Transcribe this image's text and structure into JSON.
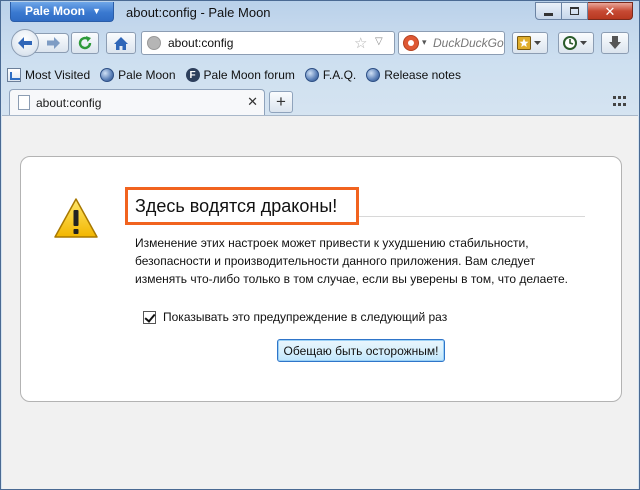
{
  "titlebar": {
    "app_menu_label": "Pale Moon",
    "window_title": "about:config - Pale Moon"
  },
  "navbar": {
    "url": "about:config",
    "search_placeholder": "DuckDuckGo"
  },
  "bookmarks": {
    "items": [
      {
        "label": "Most Visited",
        "icon": "most-visited-icon"
      },
      {
        "label": "Pale Moon",
        "icon": "globe-icon"
      },
      {
        "label": "Pale Moon forum",
        "icon": "forum-f-icon"
      },
      {
        "label": "F.A.Q.",
        "icon": "globe-icon"
      },
      {
        "label": "Release notes",
        "icon": "globe-icon"
      }
    ]
  },
  "tabs": [
    {
      "label": "about:config",
      "active": true
    }
  ],
  "warning": {
    "heading": "Здесь водятся драконы!",
    "description": "Изменение этих настроек может привести к ухудшению стабильности, безопасности и производительности данного приложения. Вам следует изменять что-либо только в том случае, если вы уверены в том, что делаете.",
    "checkbox_label": "Показывать это предупреждение в следующий раз",
    "checkbox_checked": true,
    "confirm_button": "Обещаю быть осторожным!"
  },
  "colors": {
    "highlight_border": "#f1631f",
    "app_button": "#3a79d0"
  }
}
